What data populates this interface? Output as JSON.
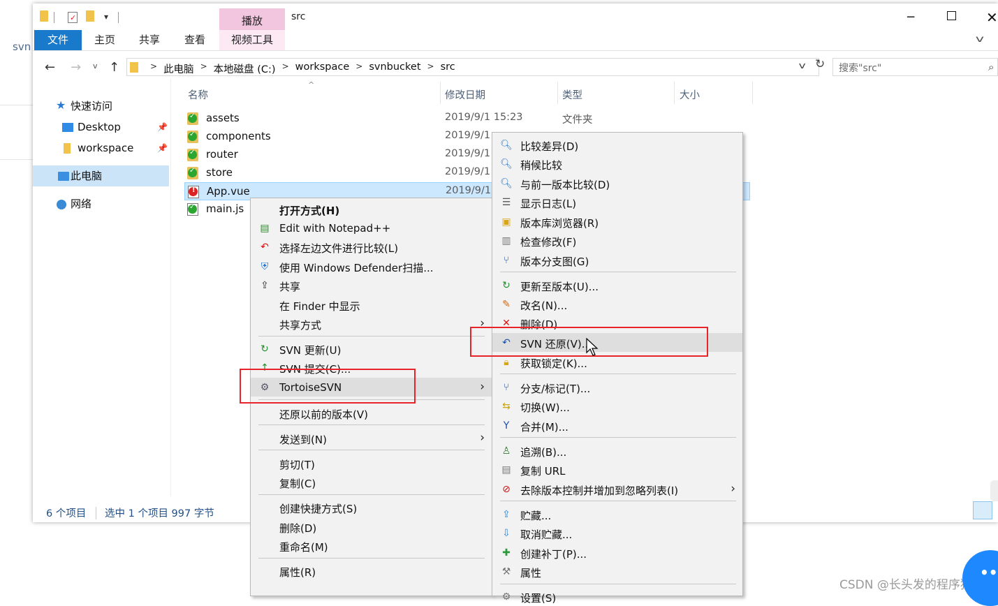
{
  "background": {
    "side_text": "svn"
  },
  "window": {
    "title": "src",
    "play_tab": "播放",
    "controls": {
      "minimize": "─",
      "maximize": "",
      "close": "✕"
    }
  },
  "ribbon": {
    "tabs": [
      "文件",
      "主页",
      "共享",
      "查看",
      "视频工具"
    ],
    "expand_icon": "chevron-down-icon"
  },
  "address": {
    "crumbs": [
      "此电脑",
      "本地磁盘 (C:)",
      "workspace",
      "svnbucket",
      "src"
    ],
    "search_placeholder": "搜索\"src\""
  },
  "navpane": {
    "items": [
      {
        "label": "快速访问",
        "icon": "star-icon"
      },
      {
        "label": "Desktop",
        "icon": "desktop-icon",
        "pinned": true
      },
      {
        "label": "workspace",
        "icon": "folder-icon",
        "pinned": true
      },
      {
        "label": "此电脑",
        "icon": "computer-icon",
        "selected": true
      },
      {
        "label": "网络",
        "icon": "network-icon"
      }
    ]
  },
  "columns": {
    "name": "名称",
    "date": "修改日期",
    "type": "类型",
    "size": "大小"
  },
  "files": [
    {
      "name": "assets",
      "date": "2019/9/1 15:23",
      "type": "文件夹",
      "kind": "folder",
      "svn": "ok"
    },
    {
      "name": "components",
      "date": "2019/9/1",
      "type": "",
      "kind": "folder",
      "svn": "ok"
    },
    {
      "name": "router",
      "date": "2019/9/1",
      "type": "",
      "kind": "folder",
      "svn": "ok"
    },
    {
      "name": "store",
      "date": "2019/9/1",
      "type": "",
      "kind": "folder",
      "svn": "ok"
    },
    {
      "name": "App.vue",
      "date": "2019/9/1",
      "type": "",
      "kind": "file",
      "svn": "modified",
      "selected": true
    },
    {
      "name": "main.js",
      "date": "",
      "type": "",
      "kind": "file",
      "svn": "ok"
    }
  ],
  "status": {
    "count": "6 个项目",
    "selection": "选中 1 个项目  997 字节"
  },
  "context_menu": {
    "items": [
      {
        "label": "打开方式(H)",
        "bold": true
      },
      {
        "label": "Edit with Notepad++",
        "icon": "notepad-icon"
      },
      {
        "label": "选择左边文件进行比较(L)",
        "icon": "compare-arrow-icon"
      },
      {
        "label": "使用 Windows Defender扫描...",
        "icon": "defender-shield-icon"
      },
      {
        "label": "共享",
        "icon": "share-icon"
      },
      {
        "label": "在 Finder 中显示"
      },
      {
        "label": "共享方式",
        "submenu": true
      },
      {
        "label": "SVN 更新(U)",
        "icon": "svn-update-icon"
      },
      {
        "label": "SVN 提交(C)...",
        "icon": "svn-commit-icon"
      },
      {
        "label": "TortoiseSVN",
        "icon": "tortoisesvn-icon",
        "submenu": true,
        "highlighted": true
      },
      {
        "label": "还原以前的版本(V)"
      },
      {
        "label": "发送到(N)",
        "submenu": true
      },
      {
        "label": "剪切(T)"
      },
      {
        "label": "复制(C)"
      },
      {
        "label": "创建快捷方式(S)"
      },
      {
        "label": "删除(D)"
      },
      {
        "label": "重命名(M)"
      },
      {
        "label": "属性(R)"
      }
    ]
  },
  "svn_menu": {
    "items": [
      {
        "label": "比较差异(D)",
        "icon": "magnifier-icon"
      },
      {
        "label": "稍候比较",
        "icon": "magnifier-icon"
      },
      {
        "label": "与前一版本比较(D)",
        "icon": "magnifier-icon"
      },
      {
        "label": "显示日志(L)",
        "icon": "log-icon"
      },
      {
        "label": "版本库浏览器(R)",
        "icon": "repo-browser-icon"
      },
      {
        "label": "检查修改(F)",
        "icon": "check-modifications-icon"
      },
      {
        "label": "版本分支图(G)",
        "icon": "revision-graph-icon"
      },
      {
        "label": "更新至版本(U)...",
        "icon": "update-revision-icon"
      },
      {
        "label": "改名(N)...",
        "icon": "rename-icon"
      },
      {
        "label": "删除(D)",
        "icon": "delete-icon"
      },
      {
        "label": "SVN 还原(V)...",
        "icon": "revert-icon",
        "highlighted": true
      },
      {
        "label": "获取锁定(K)...",
        "icon": "lock-icon"
      },
      {
        "label": "分支/标记(T)...",
        "icon": "branch-icon"
      },
      {
        "label": "切换(W)...",
        "icon": "switch-icon"
      },
      {
        "label": "合并(M)...",
        "icon": "merge-icon"
      },
      {
        "label": "追溯(B)...",
        "icon": "blame-icon"
      },
      {
        "label": "复制 URL",
        "icon": "copy-url-icon"
      },
      {
        "label": "去除版本控制并增加到忽略列表(I)",
        "icon": "ignore-icon",
        "submenu": true
      },
      {
        "label": "贮藏...",
        "icon": "shelve-icon"
      },
      {
        "label": "取消贮藏...",
        "icon": "unshelve-icon"
      },
      {
        "label": "创建补丁(P)...",
        "icon": "patch-icon"
      },
      {
        "label": "属性",
        "icon": "properties-icon"
      },
      {
        "label": "设置(S)",
        "icon": "settings-icon"
      }
    ]
  },
  "watermark": "CSDN @长头发的程序猿",
  "colors": {
    "accent": "#1979ca",
    "selection": "#cce8ff",
    "highlight_box": "#e8242a",
    "menu_bg": "#f2f2f2"
  }
}
